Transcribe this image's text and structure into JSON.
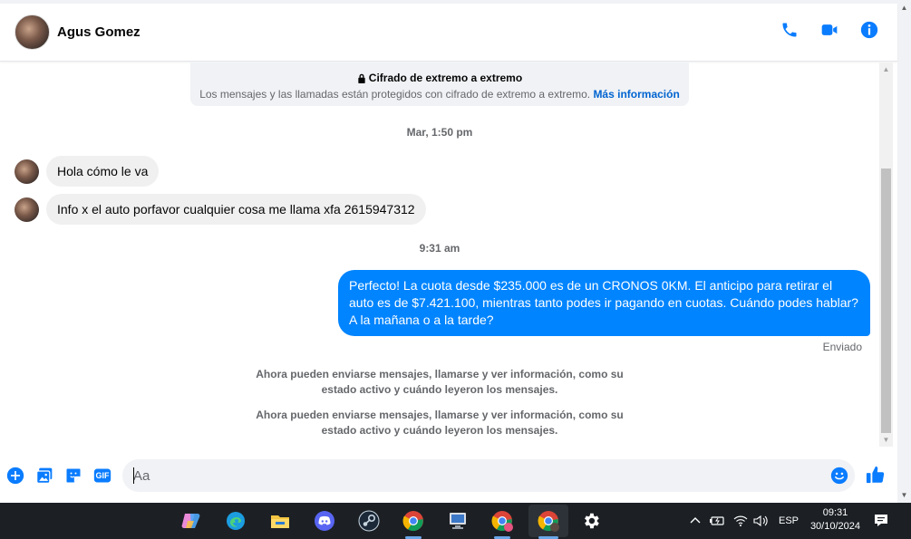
{
  "header": {
    "contact_name": "Agus Gomez"
  },
  "encryption": {
    "title": "Cifrado de extremo a extremo",
    "text": "Los mensajes y las llamadas están protegidos con cifrado de extremo a extremo.",
    "link": "Más información"
  },
  "messages": {
    "timestamp_1": "Mar, 1:50 pm",
    "incoming_1": "Hola cómo le va",
    "incoming_2": "Info x el auto porfavor cualquier cosa me llama xfa 2615947312",
    "timestamp_2": "9:31 am",
    "outgoing_1": "Perfecto! La cuota desde $235.000 es de un CRONOS 0KM. El anticipo para retirar el auto es de $7.421.100, mientras tanto podes ir pagando en cuotas. Cuándo podes hablar? A la mañana o a la tarde?",
    "outgoing_status": "Enviado",
    "system_1": "Ahora pueden enviarse mensajes, llamarse y ver información, como su estado activo y cuándo leyeron los mensajes.",
    "system_2": "Ahora pueden enviarse mensajes, llamarse y ver información, como su estado activo y cuándo leyeron los mensajes."
  },
  "composer": {
    "placeholder": "Aa",
    "gif_label": "GIF"
  },
  "taskbar": {
    "language": "ESP",
    "time": "09:31",
    "date": "30/10/2024"
  },
  "colors": {
    "accent": "#0084ff",
    "link": "#0064d1",
    "icon_blue": "#0a7cff"
  },
  "icons": {
    "call": "phone-icon",
    "video": "video-camera-icon",
    "info": "info-icon",
    "lock": "lock-icon",
    "emoji": "emoji-icon",
    "like": "thumbs-up-icon"
  }
}
